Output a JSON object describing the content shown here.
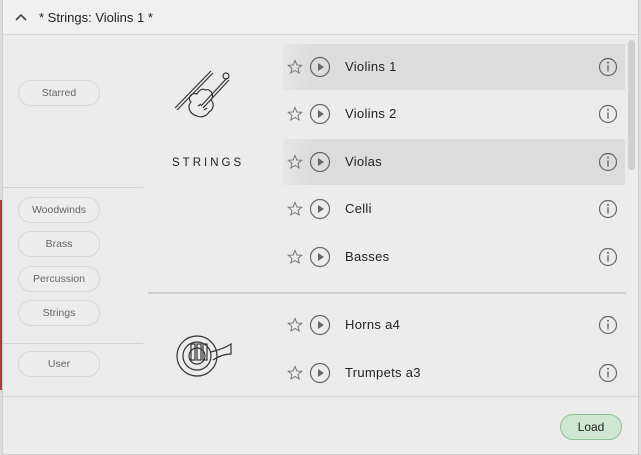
{
  "header": {
    "title": "* Strings: Violins 1 *",
    "collapse_icon": "chevron-up-icon"
  },
  "sidebar": {
    "starred": "Starred",
    "woodwinds": "Woodwinds",
    "brass": "Brass",
    "percussion": "Percussion",
    "strings": "Strings",
    "user": "User"
  },
  "categories": {
    "strings": {
      "label": "STRINGS",
      "rows": [
        {
          "name": "Violins 1",
          "highlighted": true
        },
        {
          "name": "Violins 2",
          "highlighted": false
        },
        {
          "name": "Violas",
          "highlighted": true
        },
        {
          "name": "Celli",
          "highlighted": false
        },
        {
          "name": "Basses",
          "highlighted": false
        }
      ]
    },
    "brass": {
      "rows": [
        {
          "name": "Horns a4",
          "highlighted": false
        },
        {
          "name": "Trumpets a3",
          "highlighted": false
        }
      ]
    }
  },
  "footer": {
    "load_label": "Load"
  },
  "colors": {
    "load_bg": "#cfe7d2",
    "load_border": "#8fbf96",
    "row_highlight": "#dcdcdc"
  }
}
